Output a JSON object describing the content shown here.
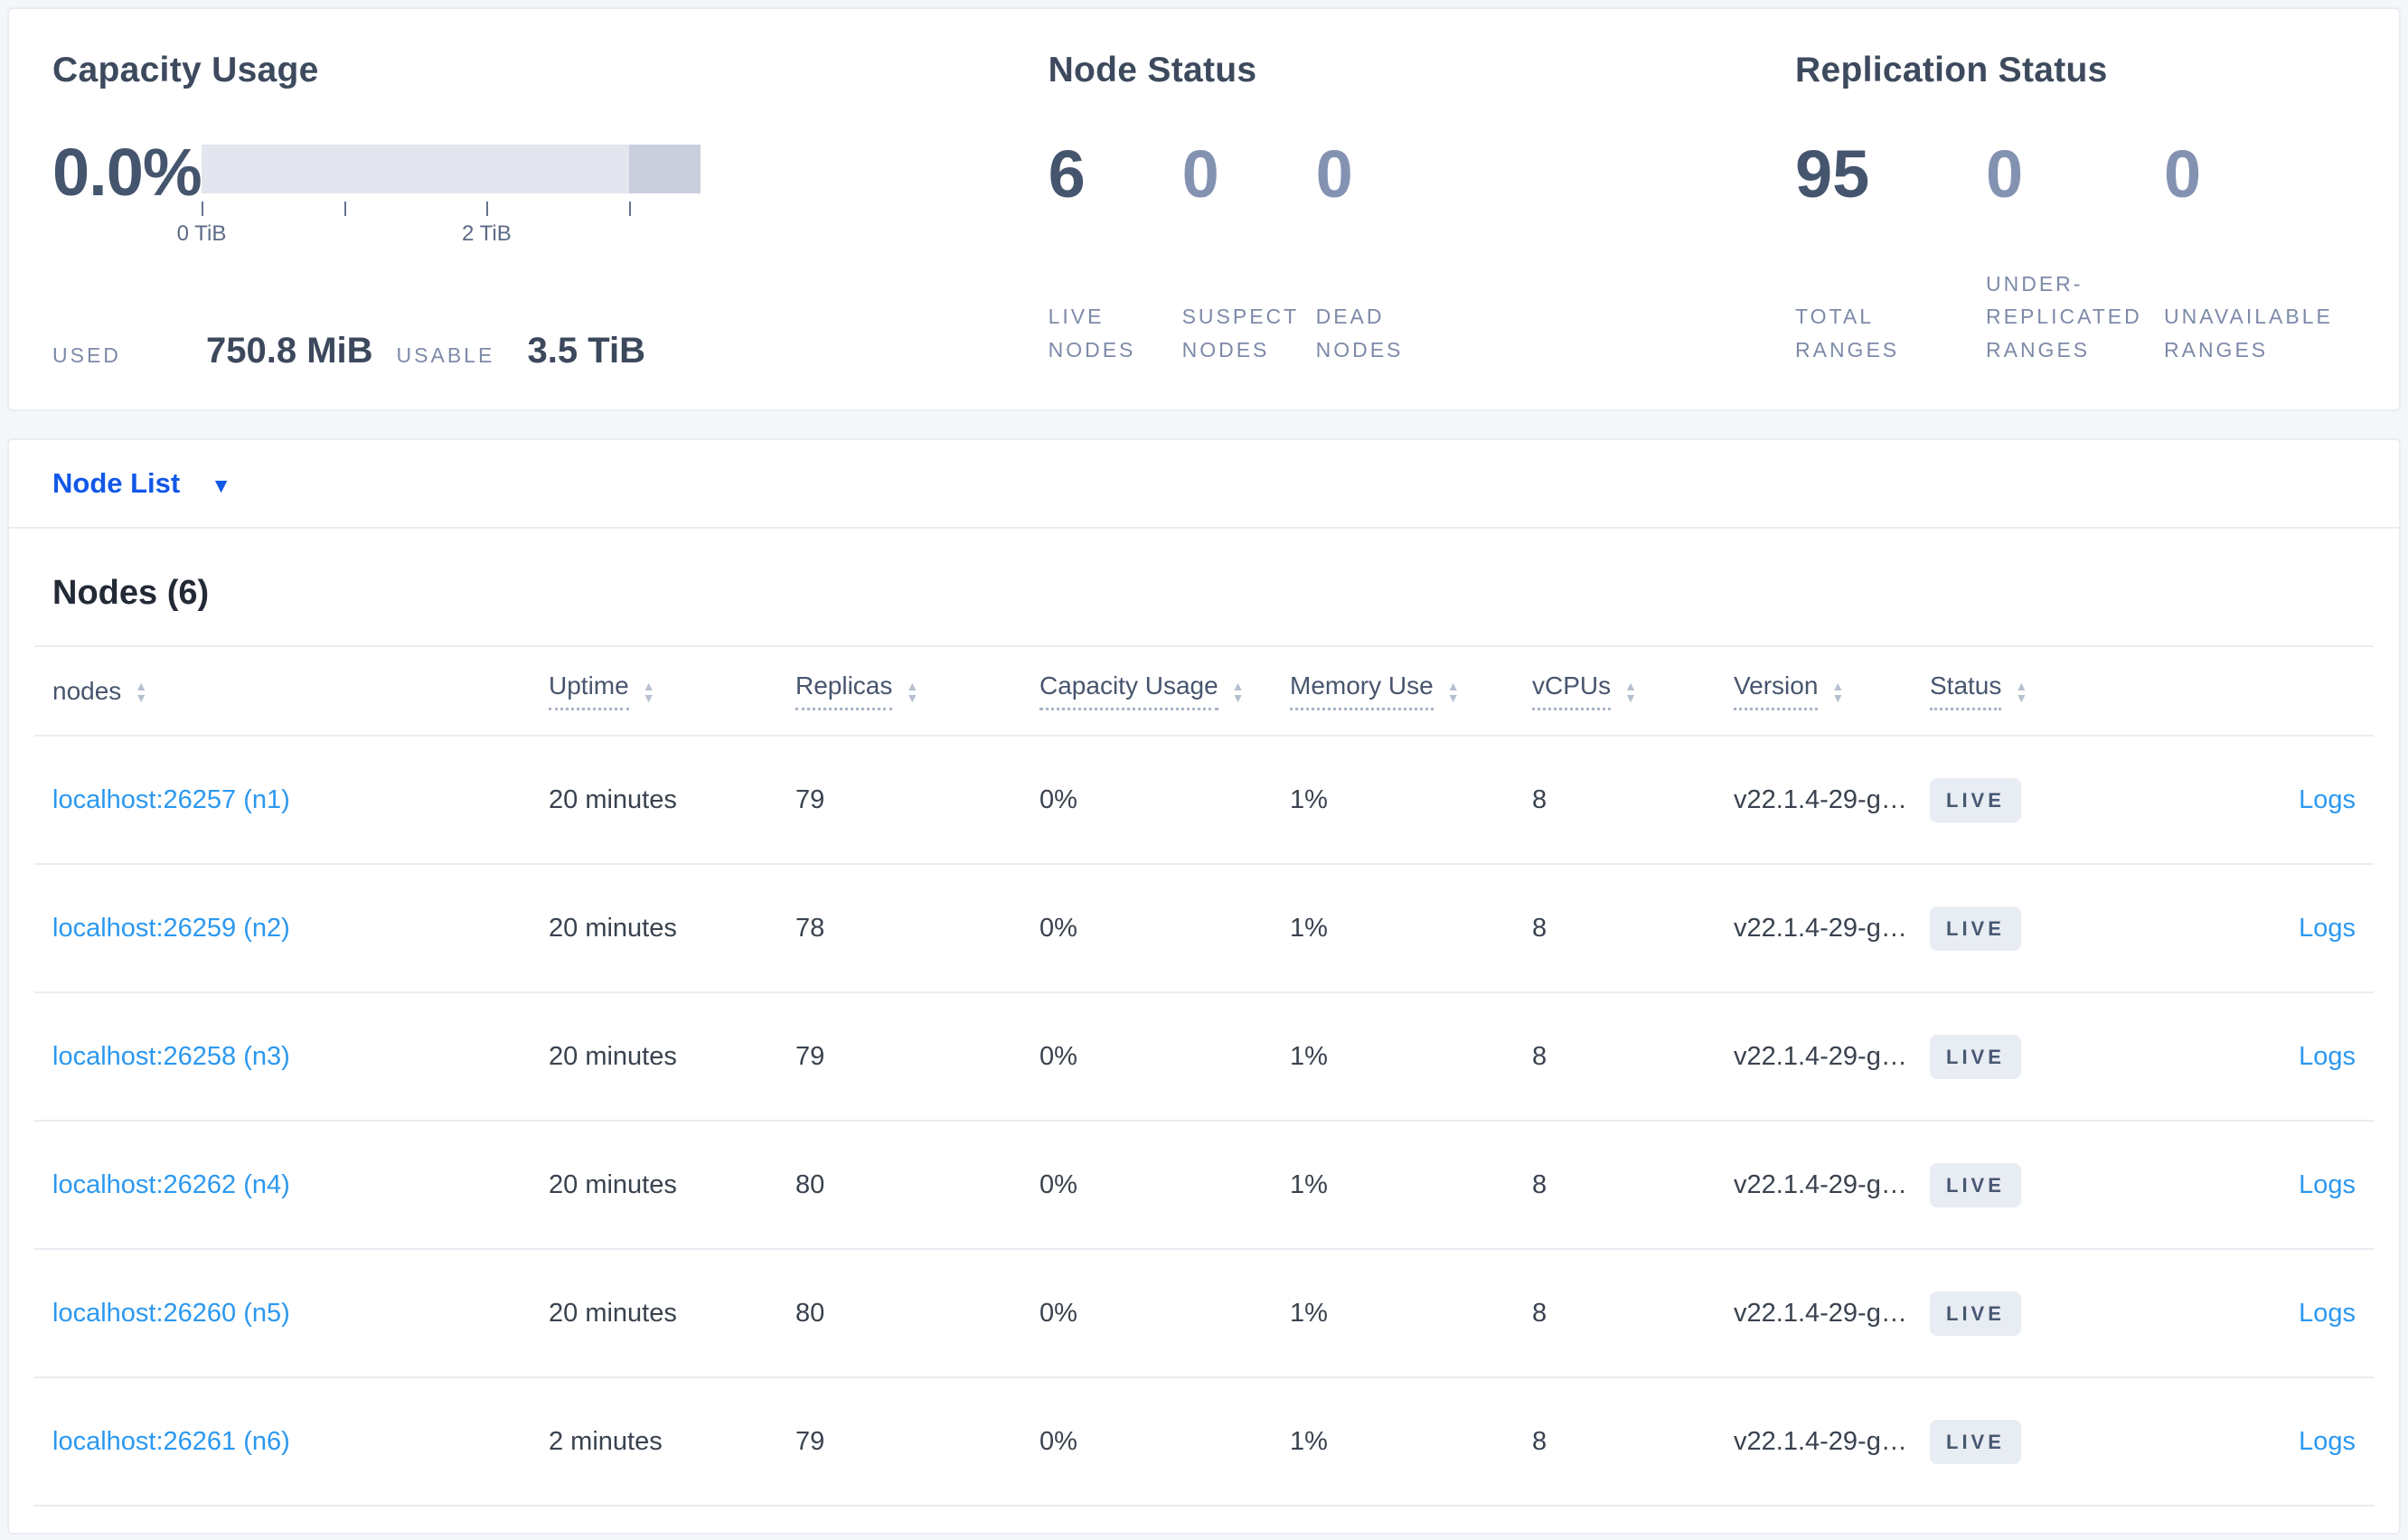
{
  "summary": {
    "capacity": {
      "title": "Capacity Usage",
      "percent": "0.0%",
      "used_label": "USED",
      "used_value": "750.8 MiB",
      "usable_label": "USABLE",
      "usable_value": "3.5 TiB",
      "bar": {
        "track_color": "#e3e6ee",
        "overflow_color": "#cacfdd",
        "dark_from": "85.71%"
      },
      "ticks": [
        {
          "label": "0 TiB",
          "x": "0%"
        },
        {
          "label": "",
          "x": "28.57%"
        },
        {
          "label": "2 TiB",
          "x": "57.14%"
        },
        {
          "label": "",
          "x": "85.71%"
        }
      ]
    },
    "node_status": {
      "title": "Node Status",
      "stats": [
        {
          "value": "6",
          "label": "LIVE NODES"
        },
        {
          "value": "0",
          "label": "SUSPECT NODES"
        },
        {
          "value": "0",
          "label": "DEAD NODES"
        }
      ]
    },
    "replication_status": {
      "title": "Replication Status",
      "stats": [
        {
          "value": "95",
          "label": "TOTAL RANGES"
        },
        {
          "value": "0",
          "label": "UNDER-REPLICATED RANGES"
        },
        {
          "value": "0",
          "label": "UNAVAILABLE RANGES"
        }
      ]
    }
  },
  "node_list": {
    "dropdown_label": "Node List",
    "section_title": "Nodes (6)",
    "columns": [
      {
        "label": "nodes"
      },
      {
        "label": "Uptime"
      },
      {
        "label": "Replicas"
      },
      {
        "label": "Capacity Usage"
      },
      {
        "label": "Memory Use"
      },
      {
        "label": "vCPUs"
      },
      {
        "label": "Version"
      },
      {
        "label": "Status"
      }
    ],
    "logs_label": "Logs",
    "rows": [
      {
        "node": "localhost:26257 (n1)",
        "uptime": "20 minutes",
        "replicas": "79",
        "capacity_usage": "0%",
        "memory_use": "1%",
        "vcpus": "8",
        "version": "v22.1.4-29-g…",
        "status": "LIVE"
      },
      {
        "node": "localhost:26259 (n2)",
        "uptime": "20 minutes",
        "replicas": "78",
        "capacity_usage": "0%",
        "memory_use": "1%",
        "vcpus": "8",
        "version": "v22.1.4-29-g…",
        "status": "LIVE"
      },
      {
        "node": "localhost:26258 (n3)",
        "uptime": "20 minutes",
        "replicas": "79",
        "capacity_usage": "0%",
        "memory_use": "1%",
        "vcpus": "8",
        "version": "v22.1.4-29-g…",
        "status": "LIVE"
      },
      {
        "node": "localhost:26262 (n4)",
        "uptime": "20 minutes",
        "replicas": "80",
        "capacity_usage": "0%",
        "memory_use": "1%",
        "vcpus": "8",
        "version": "v22.1.4-29-g…",
        "status": "LIVE"
      },
      {
        "node": "localhost:26260 (n5)",
        "uptime": "20 minutes",
        "replicas": "80",
        "capacity_usage": "0%",
        "memory_use": "1%",
        "vcpus": "8",
        "version": "v22.1.4-29-g…",
        "status": "LIVE"
      },
      {
        "node": "localhost:26261 (n6)",
        "uptime": "2 minutes",
        "replicas": "79",
        "capacity_usage": "0%",
        "memory_use": "1%",
        "vcpus": "8",
        "version": "v22.1.4-29-g…",
        "status": "LIVE"
      }
    ]
  },
  "icons": {
    "caret_down": "▼",
    "sort_asc": "▲",
    "sort_desc": "▼"
  },
  "colors": {
    "accent_blue": "#1158e8",
    "link_blue": "#2b98f0",
    "dark_slate": "#45556e",
    "muted_slate": "#7d8aa8",
    "badge_bg": "#e8ecf3",
    "bar_track": "#e3e6ee",
    "bar_overflow": "#cacfdd",
    "page_bg": "#f4f6fa"
  }
}
